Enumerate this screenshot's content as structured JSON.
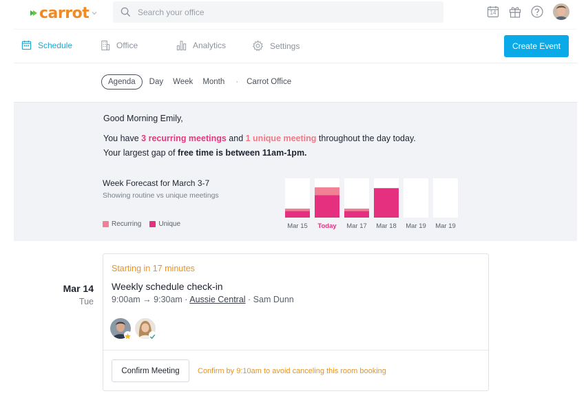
{
  "header": {
    "logo_text": "carrot",
    "search_placeholder": "Search your office",
    "calendar_day": "14"
  },
  "nav": {
    "items": [
      {
        "label": "Schedule",
        "active": true
      },
      {
        "label": "Office",
        "active": false
      },
      {
        "label": "Analytics",
        "active": false
      },
      {
        "label": "Settings",
        "active": false
      }
    ],
    "create_label": "Create Event"
  },
  "views": {
    "items": [
      "Agenda",
      "Day",
      "Week",
      "Month"
    ],
    "active": "Agenda",
    "separator": "·",
    "office": "Carrot Office"
  },
  "summary": {
    "greeting": "Good Morning Emily,",
    "line1_pre": "You have ",
    "line1_recurring": "3 recurring meetings",
    "line1_mid": " and ",
    "line1_unique": "1 unique meeting",
    "line1_post": " throughout the day today.",
    "line2_pre": "Your largest gap of ",
    "line2_bold": "free time is between 11am-1pm.",
    "forecast_title": "Week Forecast for March 3-7",
    "forecast_sub": "Showing routine vs unique meetings",
    "legend_recurring": "Recurring",
    "legend_unique": "Unique"
  },
  "colors": {
    "accent": "#0aa9e8",
    "nav_active": "#1ba7cf",
    "recurring": "#f08194",
    "unique": "#e5307f",
    "warning": "#e8931f",
    "logo": "#f08a24"
  },
  "chart_data": {
    "type": "bar",
    "stacked": true,
    "categories": [
      "Mar 15",
      "Today",
      "Mar 17",
      "Mar 18",
      "Mar 19",
      "Mar 19"
    ],
    "highlight_category": "Today",
    "series": [
      {
        "name": "Unique",
        "values": [
          0.17,
          0.57,
          0.17,
          0.75,
          0,
          0
        ]
      },
      {
        "name": "Recurring",
        "values": [
          0.06,
          0.2,
          0.06,
          0,
          0,
          0
        ]
      }
    ],
    "ylim": [
      0,
      1
    ],
    "grid": false
  },
  "agenda": {
    "date": "Mar 14",
    "weekday": "Tue",
    "event": {
      "starting": "Starting in 17 minutes",
      "title": "Weekly schedule check-in",
      "time": "9:00am → 9:30am · ",
      "room": "Aussie Central",
      "host": " · Sam Dunn",
      "confirm_label": "Confirm Meeting",
      "confirm_note": "Confirm by 9:10am to avoid canceling this room booking"
    }
  }
}
